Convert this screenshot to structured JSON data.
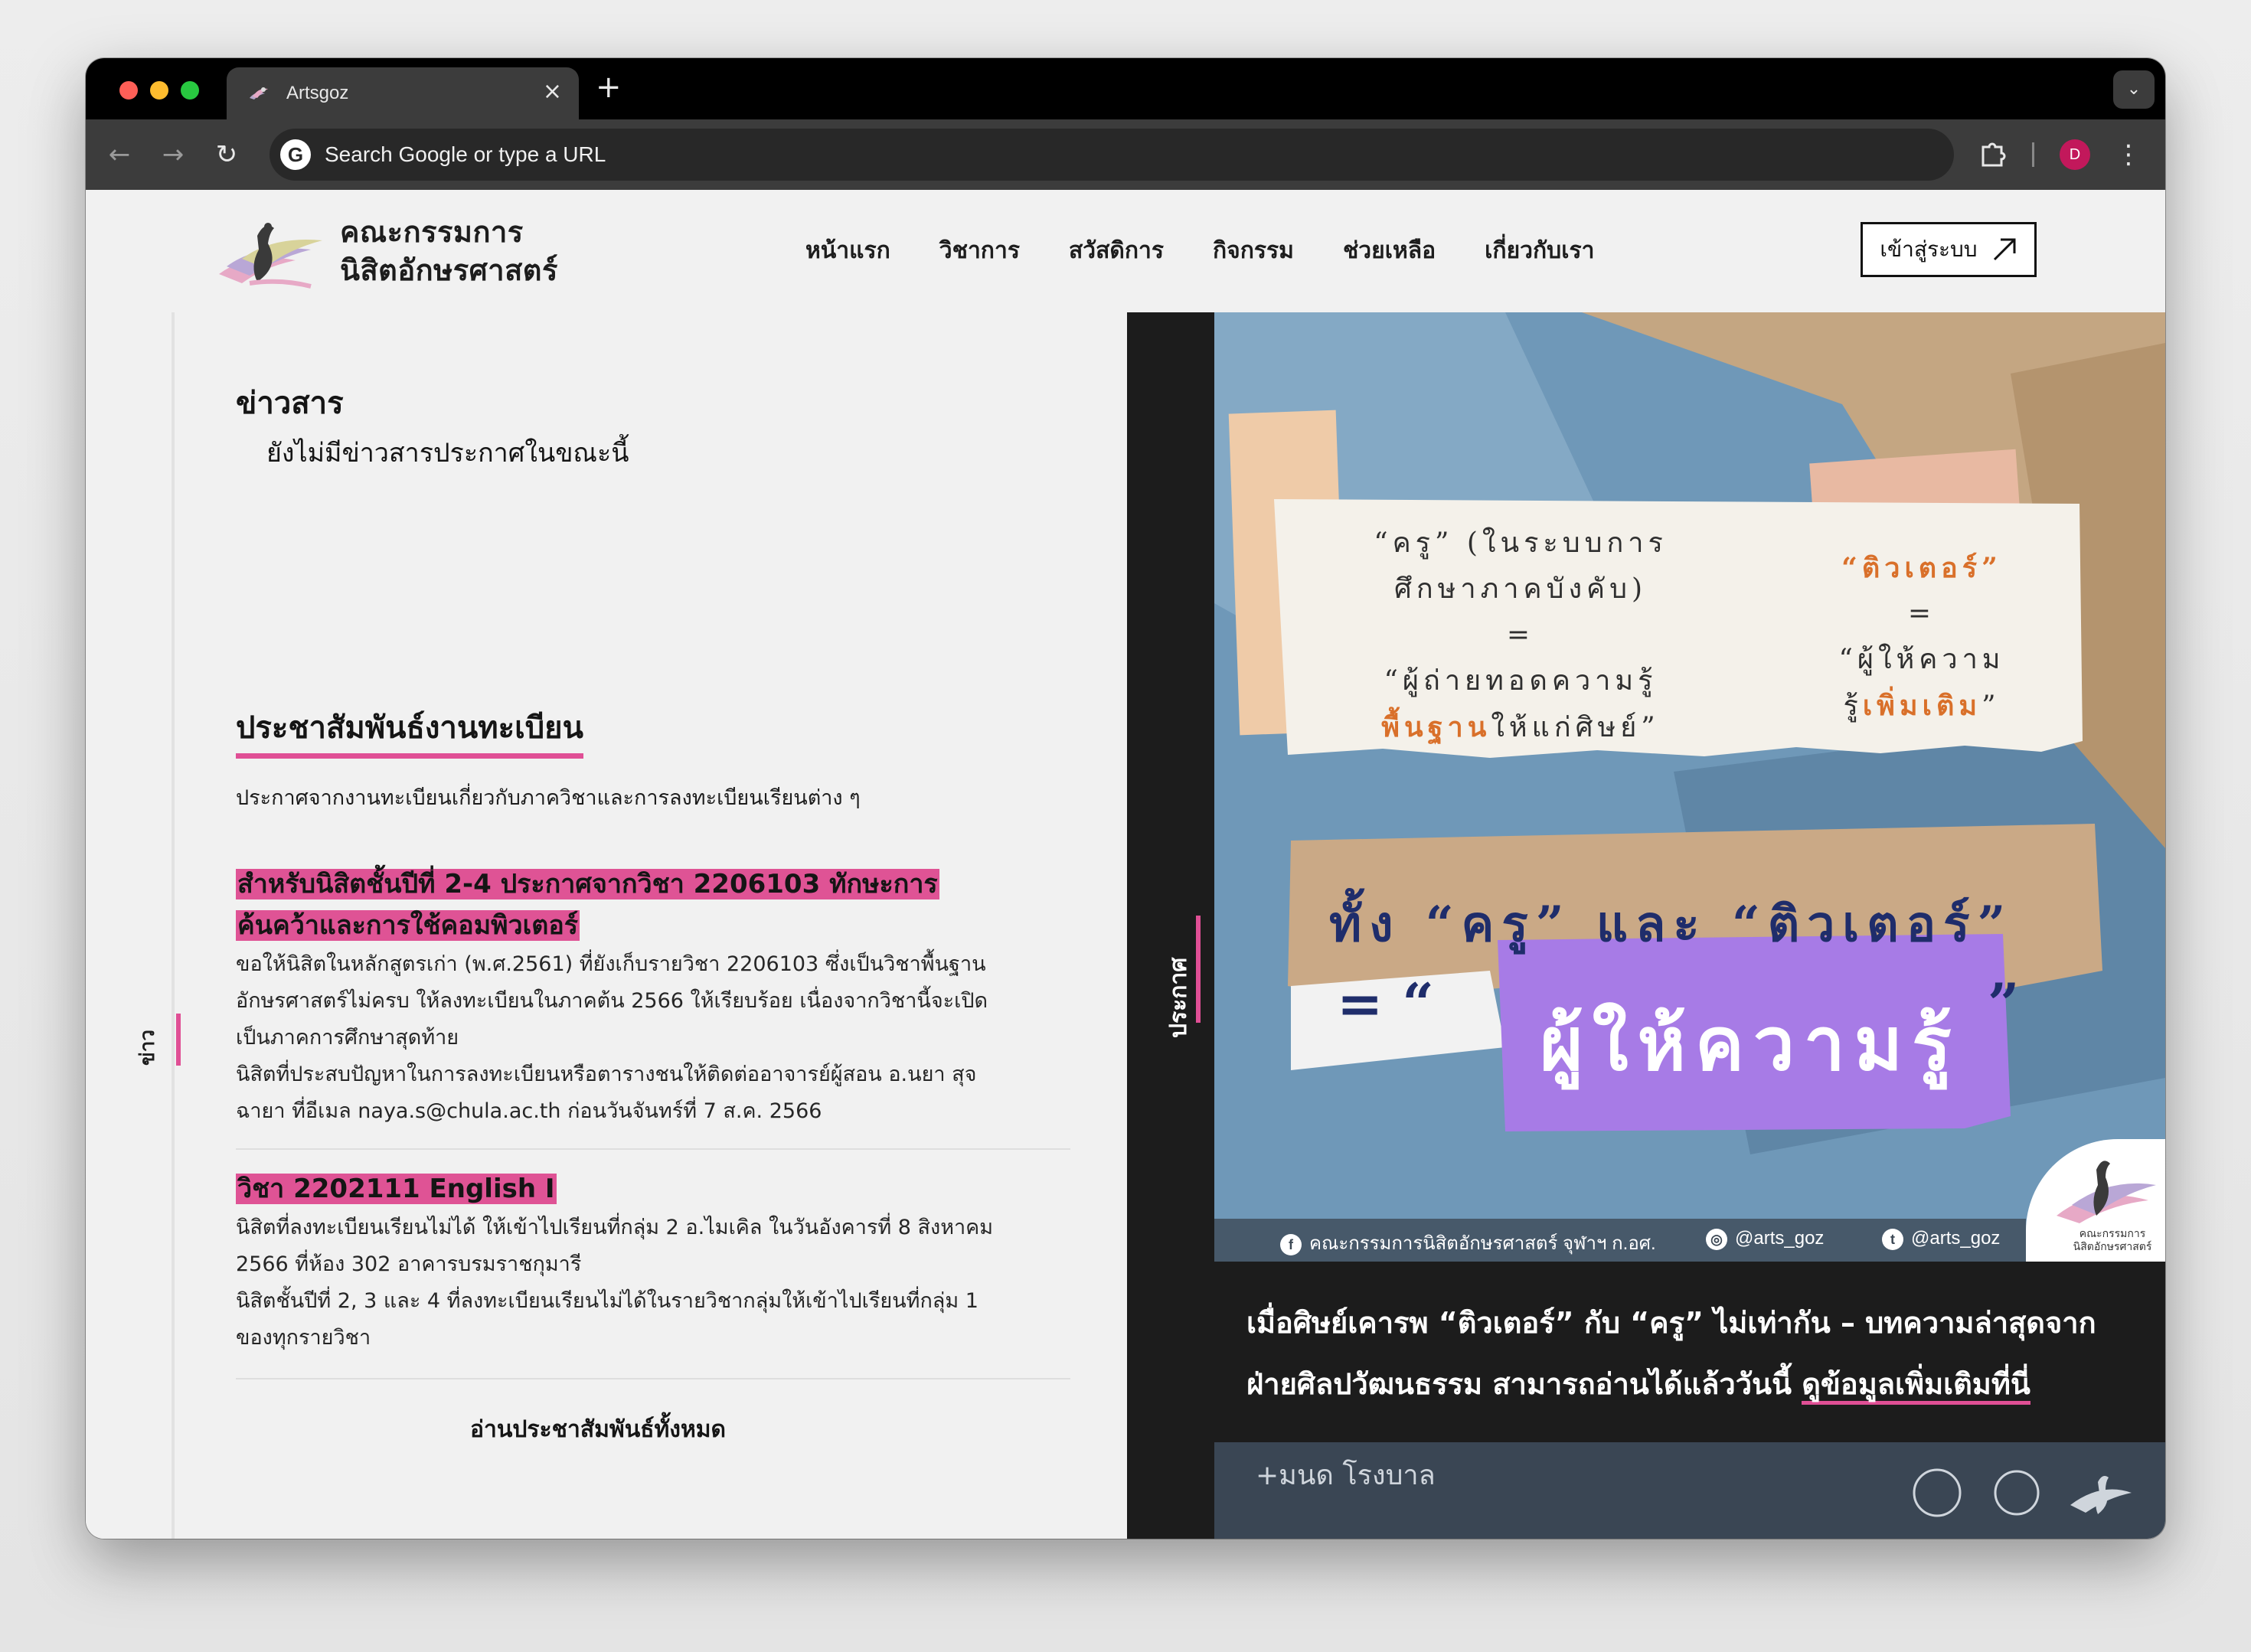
{
  "browser": {
    "tab_title": "Artsgoz",
    "tab_close": "×",
    "new_tab": "+",
    "omnibox_placeholder": "Search Google or type a URL",
    "google_letter": "G",
    "profile_initial": "D",
    "colors": {
      "frame": "#000000",
      "toolbar": "#3c3c3c",
      "omnibox": "#282828",
      "profile": "#c2185b"
    }
  },
  "site": {
    "logo_line1": "คณะกรรมการ",
    "logo_line2": "นิสิตอักษรศาสตร์",
    "nav": [
      "หน้าแรก",
      "วิชาการ",
      "สวัสดิการ",
      "กิจกรรม",
      "ช่วยเหลือ",
      "เกี่ยวกับเรา"
    ],
    "login_label": "เข้าสู่ระบบ",
    "accent_color": "#e04f95"
  },
  "side_tab": {
    "label": "ข่าว"
  },
  "news": {
    "title": "ข่าวสาร",
    "empty_message": "ยังไม่มีข่าวสารประกาศในขณะนี้"
  },
  "pr": {
    "title": "ประชาสัมพันธ์งานทะเบียน",
    "description": "ประกาศจากงานทะเบียนเกี่ยวกับภาควิชาและการลงทะเบียนเรียนต่าง ๆ",
    "items": [
      {
        "heading_line1": "สำหรับนิสิตชั้นปีที่ 2-4 ประกาศจากวิชา 2206103 ทักษะการ",
        "heading_line2": "ค้นคว้าและการใช้คอมพิวเตอร์",
        "body_line1": "ขอให้นิสิตในหลักสูตรเก่า (พ.ศ.2561) ที่ยังเก็บรายวิชา 2206103 ซึ่งเป็นวิชาพื้นฐาน",
        "body_line2": "อักษรศาสตร์ไม่ครบ ให้ลงทะเบียนในภาคต้น 2566 ให้เรียบร้อย เนื่องจากวิชานี้จะเปิด",
        "body_line3": "เป็นภาคการศึกษาสุดท้าย",
        "body_line4": "นิสิตที่ประสบปัญหาในการลงทะเบียนหรือตารางชนให้ติดต่ออาจารย์ผู้สอน อ.นยา สุจ",
        "body_line5": "ฉายา ที่อีเมล naya.s@chula.ac.th ก่อนวันจันทร์ที่ 7 ส.ค. 2566"
      },
      {
        "heading_line1": "วิชา 2202111 English I",
        "body_line1": "นิสิตที่ลงทะเบียนเรียนไม่ได้ ให้เข้าไปเรียนที่กลุ่ม 2 อ.ไมเคิล ในวันอังคารที่ 8 สิงหาคม",
        "body_line2": "2566 ที่ห้อง 302 อาคารบรมราชกุมารี",
        "body_line3": "นิสิตชั้นปีที่ 2, 3 และ 4 ที่ลงทะเบียนเรียนไม่ได้ในรายวิชากลุ่มให้เข้าไปเรียนที่กลุ่ม 1",
        "body_line4": "ของทุกรายวิชา"
      }
    ],
    "read_all": "อ่านประชาสัมพันธ์ทั้งหมด"
  },
  "announcement": {
    "rail_label": "ประกาศ",
    "poster": {
      "left_note_1": "“ครู” (ในระบบการ",
      "left_note_1_highlight": "ครู",
      "left_note_2": "ศึกษาภาคบังคับ)",
      "left_note_3": "=",
      "left_note_4": "“ผู้ถ่ายทอดความรู้",
      "left_note_5_highlight": "พื้นฐาน",
      "left_note_5_rest": "ให้แก่ศิษย์”",
      "right_note_1": "“ติวเตอร์”",
      "right_note_2": "=",
      "right_note_3": "“ผู้ให้ความ",
      "right_note_4a": "รู้",
      "right_note_4b": "เพิ่มเติม",
      "right_note_4c": "”",
      "big_line": "ทั้ง “ครู” และ “ติวเตอร์”",
      "equals": "= “",
      "close_quote": "”",
      "purple_text": "ผู้ให้ความรู้",
      "footer_fb": "คณะกรรมการนิสิตอักษรศาสตร์ จุฬาฯ ก.อศ.",
      "footer_ig": "@arts_goz",
      "footer_tw": "@arts_goz",
      "corner_logo_text": "คณะกรรมการ นิสิตอักษรศาสตร์"
    },
    "caption": "เมื่อศิษย์เคารพ “ติวเตอร์” กับ “ครู” ไม่เท่ากัน – บทความล่าสุดจากฝ่ายศิลปวัฒนธรรม สามารถอ่านได้แล้ววันนี้ ",
    "caption_link": "ดูข้อมูลเพิ่มเติมที่นี่",
    "footer_left_logo": "+มนด โรงบาล"
  }
}
